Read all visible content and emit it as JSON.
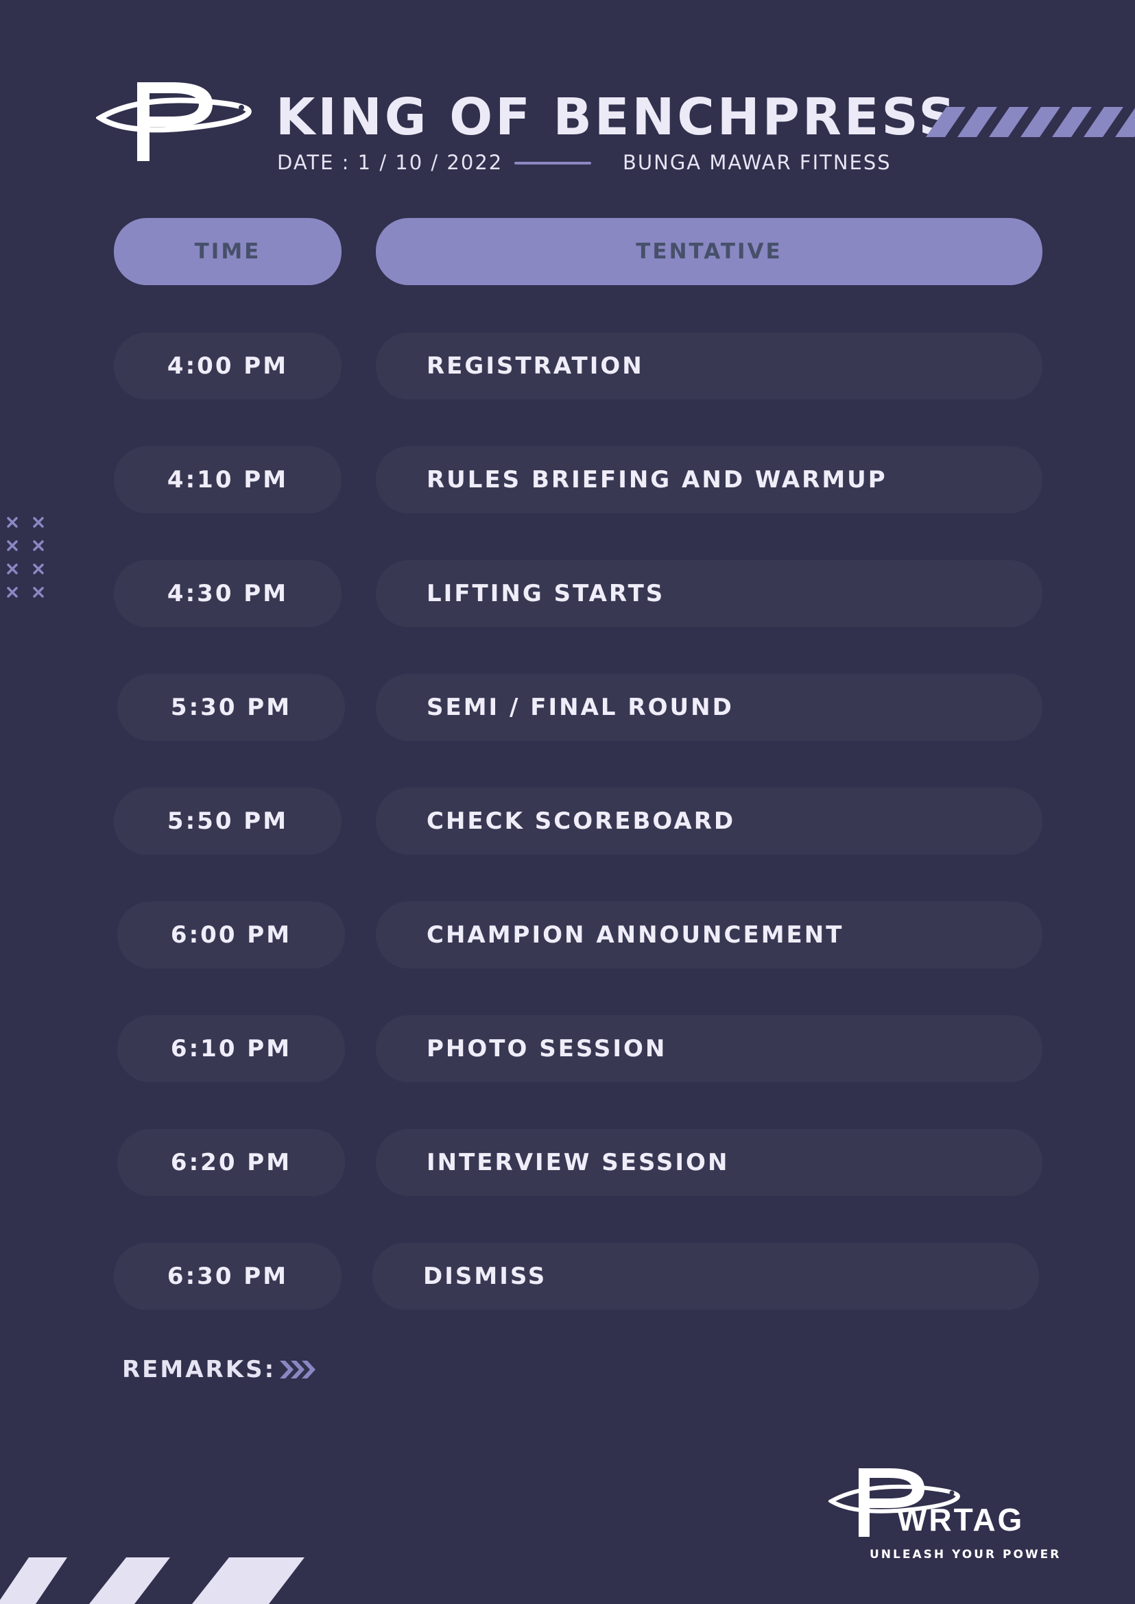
{
  "event": {
    "title": "KING OF BENCHPRESS",
    "date_text": "DATE : 1 / 10 / 2022",
    "venue": "BUNGA MAWAR FITNESS"
  },
  "table": {
    "headers": {
      "time": "TIME",
      "tentative": "TENTATIVE"
    },
    "rows": [
      {
        "time": "4:00 PM",
        "activity": "REGISTRATION"
      },
      {
        "time": "4:10 PM",
        "activity": "RULES BRIEFING AND WARMUP"
      },
      {
        "time": "4:30 PM",
        "activity": "LIFTING STARTS"
      },
      {
        "time": "5:30 PM",
        "activity": "SEMI / FINAL ROUND"
      },
      {
        "time": "5:50 PM",
        "activity": "CHECK SCOREBOARD"
      },
      {
        "time": "6:00 PM",
        "activity": "CHAMPION ANNOUNCEMENT"
      },
      {
        "time": "6:10 PM",
        "activity": "PHOTO SESSION"
      },
      {
        "time": "6:20 PM",
        "activity": "INTERVIEW SESSION"
      },
      {
        "time": "6:30 PM",
        "activity": "DISMISS"
      }
    ]
  },
  "remarks_label": "REMARKS:",
  "brand": {
    "wordmark": "PWRTAG",
    "wordmark_suffix": "WRTAG",
    "tagline": "UNLEASH YOUR POWER"
  },
  "colors": {
    "background": "#31304d",
    "accent": "#8a88c3",
    "pill": "#393853",
    "text": "#efedf8"
  }
}
